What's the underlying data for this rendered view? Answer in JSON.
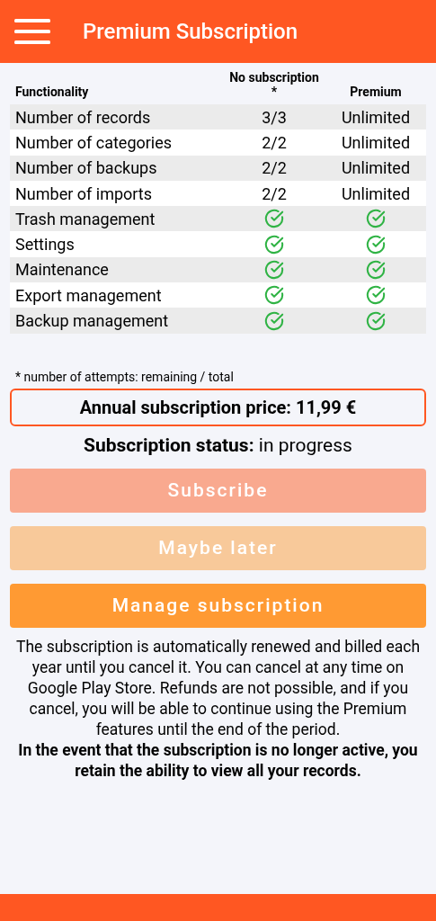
{
  "header": {
    "title": "Premium Subscription"
  },
  "table": {
    "columns": [
      "Functionality",
      "No subscription\n*",
      "Premium"
    ],
    "rows": [
      {
        "cells": [
          {
            "kind": "text",
            "text": "Number of records"
          },
          {
            "kind": "text",
            "text": "3/3"
          },
          {
            "kind": "text",
            "text": "Unlimited"
          }
        ]
      },
      {
        "cells": [
          {
            "kind": "text",
            "text": "Number of categories"
          },
          {
            "kind": "text",
            "text": "2/2"
          },
          {
            "kind": "text",
            "text": "Unlimited"
          }
        ]
      },
      {
        "cells": [
          {
            "kind": "text",
            "text": "Number of backups"
          },
          {
            "kind": "text",
            "text": "2/2"
          },
          {
            "kind": "text",
            "text": "Unlimited"
          }
        ]
      },
      {
        "cells": [
          {
            "kind": "text",
            "text": "Number of imports"
          },
          {
            "kind": "text",
            "text": "2/2"
          },
          {
            "kind": "text",
            "text": "Unlimited"
          }
        ]
      },
      {
        "cells": [
          {
            "kind": "text",
            "text": "Trash management"
          },
          {
            "kind": "check"
          },
          {
            "kind": "check"
          }
        ]
      },
      {
        "cells": [
          {
            "kind": "text",
            "text": "Settings"
          },
          {
            "kind": "check"
          },
          {
            "kind": "check"
          }
        ]
      },
      {
        "cells": [
          {
            "kind": "text",
            "text": "Maintenance"
          },
          {
            "kind": "check"
          },
          {
            "kind": "check"
          }
        ]
      },
      {
        "cells": [
          {
            "kind": "text",
            "text": "Export management"
          },
          {
            "kind": "check"
          },
          {
            "kind": "check"
          }
        ]
      },
      {
        "cells": [
          {
            "kind": "text",
            "text": "Backup management"
          },
          {
            "kind": "check"
          },
          {
            "kind": "check"
          }
        ]
      }
    ]
  },
  "footnote": "* number of attempts: remaining / total",
  "price": "Annual subscription price: 11,99 €",
  "status": {
    "label": "Subscription status:",
    "value": "in progress"
  },
  "buttons": [
    {
      "label": "Subscribe",
      "disabled": true,
      "kind": "primary"
    },
    {
      "label": "Maybe later",
      "disabled": true,
      "kind": "secondary"
    },
    {
      "label": "Manage subscription",
      "disabled": false,
      "kind": "secondary"
    }
  ],
  "notice": "The subscription is automatically renewed and billed each year until you cancel it. You can cancel at any time on Google Play Store. Refunds are not possible, and if you cancel, you will be able to continue using the Premium features until the end of the period.",
  "notice_bold": "In the event that the subscription is no longer active, you retain the ability to view all your records."
}
